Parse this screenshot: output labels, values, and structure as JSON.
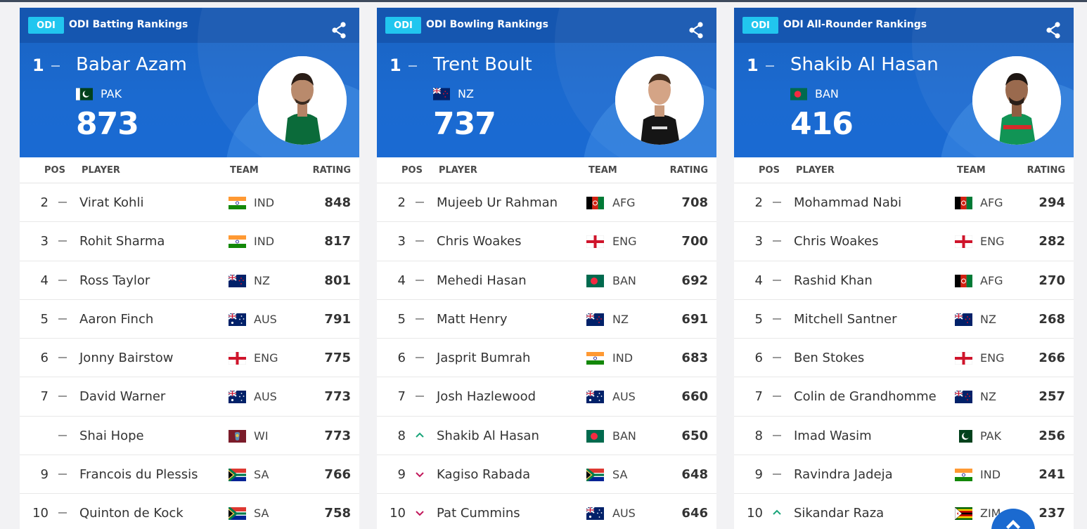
{
  "cards": [
    {
      "badge": "ODI",
      "title": "ODI Batting Rankings",
      "leader": {
        "pos": "1",
        "name": "Babar Azam",
        "team": "PAK",
        "flag": "PAK",
        "rating": "873"
      },
      "headers": {
        "pos": "POS",
        "player": "PLAYER",
        "team": "TEAM",
        "rating": "RATING"
      },
      "rows": [
        {
          "pos": "2",
          "move": "none",
          "name": "Virat Kohli",
          "flag": "IND",
          "team": "IND",
          "rating": "848"
        },
        {
          "pos": "3",
          "move": "none",
          "name": "Rohit Sharma",
          "flag": "IND",
          "team": "IND",
          "rating": "817"
        },
        {
          "pos": "4",
          "move": "none",
          "name": "Ross Taylor",
          "flag": "NZ",
          "team": "NZ",
          "rating": "801"
        },
        {
          "pos": "5",
          "move": "none",
          "name": "Aaron Finch",
          "flag": "AUS",
          "team": "AUS",
          "rating": "791"
        },
        {
          "pos": "6",
          "move": "none",
          "name": "Jonny Bairstow",
          "flag": "ENG",
          "team": "ENG",
          "rating": "775"
        },
        {
          "pos": "7",
          "move": "none",
          "name": "David Warner",
          "flag": "AUS",
          "team": "AUS",
          "rating": "773"
        },
        {
          "pos": "",
          "move": "none",
          "name": "Shai Hope",
          "flag": "WI",
          "team": "WI",
          "rating": "773"
        },
        {
          "pos": "9",
          "move": "none",
          "name": "Francois du Plessis",
          "flag": "SA",
          "team": "SA",
          "rating": "766"
        },
        {
          "pos": "10",
          "move": "none",
          "name": "Quinton de Kock",
          "flag": "SA",
          "team": "SA",
          "rating": "758"
        }
      ]
    },
    {
      "badge": "ODI",
      "title": "ODI Bowling Rankings",
      "leader": {
        "pos": "1",
        "name": "Trent Boult",
        "team": "NZ",
        "flag": "NZ",
        "rating": "737"
      },
      "headers": {
        "pos": "POS",
        "player": "PLAYER",
        "team": "TEAM",
        "rating": "RATING"
      },
      "rows": [
        {
          "pos": "2",
          "move": "none",
          "name": "Mujeeb Ur Rahman",
          "flag": "AFG",
          "team": "AFG",
          "rating": "708"
        },
        {
          "pos": "3",
          "move": "none",
          "name": "Chris Woakes",
          "flag": "ENG",
          "team": "ENG",
          "rating": "700"
        },
        {
          "pos": "4",
          "move": "none",
          "name": "Mehedi Hasan",
          "flag": "BAN",
          "team": "BAN",
          "rating": "692"
        },
        {
          "pos": "5",
          "move": "none",
          "name": "Matt Henry",
          "flag": "NZ",
          "team": "NZ",
          "rating": "691"
        },
        {
          "pos": "6",
          "move": "none",
          "name": "Jasprit Bumrah",
          "flag": "IND",
          "team": "IND",
          "rating": "683"
        },
        {
          "pos": "7",
          "move": "none",
          "name": "Josh Hazlewood",
          "flag": "AUS",
          "team": "AUS",
          "rating": "660"
        },
        {
          "pos": "8",
          "move": "up",
          "name": "Shakib Al Hasan",
          "flag": "BAN",
          "team": "BAN",
          "rating": "650"
        },
        {
          "pos": "9",
          "move": "down",
          "name": "Kagiso Rabada",
          "flag": "SA",
          "team": "SA",
          "rating": "648"
        },
        {
          "pos": "10",
          "move": "down",
          "name": "Pat Cummins",
          "flag": "AUS",
          "team": "AUS",
          "rating": "646"
        }
      ]
    },
    {
      "badge": "ODI",
      "title": "ODI All-Rounder Rankings",
      "leader": {
        "pos": "1",
        "name": "Shakib Al Hasan",
        "team": "BAN",
        "flag": "BAN",
        "rating": "416"
      },
      "headers": {
        "pos": "POS",
        "player": "PLAYER",
        "team": "TEAM",
        "rating": "RATING"
      },
      "rows": [
        {
          "pos": "2",
          "move": "none",
          "name": "Mohammad Nabi",
          "flag": "AFG",
          "team": "AFG",
          "rating": "294"
        },
        {
          "pos": "3",
          "move": "none",
          "name": "Chris Woakes",
          "flag": "ENG",
          "team": "ENG",
          "rating": "282"
        },
        {
          "pos": "4",
          "move": "none",
          "name": "Rashid Khan",
          "flag": "AFG",
          "team": "AFG",
          "rating": "270"
        },
        {
          "pos": "5",
          "move": "none",
          "name": "Mitchell Santner",
          "flag": "NZ",
          "team": "NZ",
          "rating": "268"
        },
        {
          "pos": "6",
          "move": "none",
          "name": "Ben Stokes",
          "flag": "ENG",
          "team": "ENG",
          "rating": "266"
        },
        {
          "pos": "7",
          "move": "none",
          "name": "Colin de Grandhomme",
          "flag": "NZ",
          "team": "NZ",
          "rating": "257"
        },
        {
          "pos": "8",
          "move": "none",
          "name": "Imad Wasim",
          "flag": "PAK",
          "team": "PAK",
          "rating": "256"
        },
        {
          "pos": "9",
          "move": "none",
          "name": "Ravindra Jadeja",
          "flag": "IND",
          "team": "IND",
          "rating": "241"
        },
        {
          "pos": "10",
          "move": "up",
          "name": "Sikandar Raza",
          "flag": "ZIM",
          "team": "ZIM",
          "rating": "237"
        }
      ]
    }
  ],
  "colors": {
    "brand_blue": "#1b6ad0",
    "badge_cyan": "#21c6ef",
    "up_green": "#1aa57a",
    "down_red": "#c2185b"
  },
  "icons": {
    "share": "share-icon",
    "scroll_top": "arrow-up-icon"
  }
}
